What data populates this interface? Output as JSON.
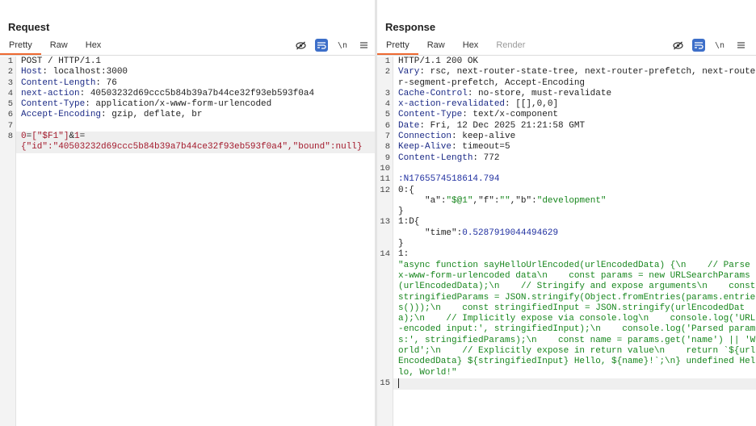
{
  "request": {
    "title": "Request",
    "tabs": [
      "Pretty",
      "Raw",
      "Hex"
    ],
    "lines": [
      {
        "n": "1",
        "parts": [
          {
            "t": "POST / HTTP/1.1",
            "c": "v"
          }
        ]
      },
      {
        "n": "2",
        "parts": [
          {
            "t": "Host",
            "c": "k"
          },
          {
            "t": ": localhost:3000",
            "c": "v"
          }
        ]
      },
      {
        "n": "3",
        "parts": [
          {
            "t": "Content-Length",
            "c": "k"
          },
          {
            "t": ": 76",
            "c": "v"
          }
        ]
      },
      {
        "n": "4",
        "parts": [
          {
            "t": "next-action",
            "c": "k"
          },
          {
            "t": ": 40503232d69ccc5b84b39a7b44ce32f93eb593f0a4",
            "c": "v"
          }
        ]
      },
      {
        "n": "5",
        "parts": [
          {
            "t": "Content-Type",
            "c": "k"
          },
          {
            "t": ": application/x-www-form-urlencoded",
            "c": "v"
          }
        ]
      },
      {
        "n": "6",
        "parts": [
          {
            "t": "Accept-Encoding",
            "c": "k"
          },
          {
            "t": ": gzip, deflate, br",
            "c": "v"
          }
        ]
      },
      {
        "n": "7",
        "parts": [
          {
            "t": "",
            "c": "v"
          }
        ]
      },
      {
        "n": "8",
        "hl": true,
        "parts": [
          {
            "t": "0",
            "c": "red"
          },
          {
            "t": "=",
            "c": "v"
          },
          {
            "t": "[\"$F1\"]",
            "c": "red"
          },
          {
            "t": "&",
            "c": "v"
          },
          {
            "t": "1",
            "c": "red"
          },
          {
            "t": "=",
            "c": "v"
          },
          {
            "t": "\n{\"id\":\"40503232d69ccc5b84b39a7b44ce32f93eb593f0a4\",\"bound\":null}",
            "c": "red"
          }
        ]
      }
    ]
  },
  "response": {
    "title": "Response",
    "tabs": [
      "Pretty",
      "Raw",
      "Hex",
      "Render"
    ],
    "lines": [
      {
        "n": "1",
        "parts": [
          {
            "t": "HTTP/1.1 200 OK",
            "c": "v"
          }
        ]
      },
      {
        "n": "2",
        "parts": [
          {
            "t": "Vary",
            "c": "k"
          },
          {
            "t": ": rsc, next-router-state-tree, next-router-prefetch, next-router-segment-prefetch, Accept-Encoding",
            "c": "v"
          }
        ]
      },
      {
        "n": "3",
        "parts": [
          {
            "t": "Cache-Control",
            "c": "k"
          },
          {
            "t": ": no-store, must-revalidate",
            "c": "v"
          }
        ]
      },
      {
        "n": "4",
        "parts": [
          {
            "t": "x-action-revalidated",
            "c": "k"
          },
          {
            "t": ": [[],0,0]",
            "c": "v"
          }
        ]
      },
      {
        "n": "5",
        "parts": [
          {
            "t": "Content-Type",
            "c": "k"
          },
          {
            "t": ": text/x-component",
            "c": "v"
          }
        ]
      },
      {
        "n": "6",
        "parts": [
          {
            "t": "Date",
            "c": "k"
          },
          {
            "t": ": Fri, 12 Dec 2025 21:21:58 GMT",
            "c": "v"
          }
        ]
      },
      {
        "n": "7",
        "parts": [
          {
            "t": "Connection",
            "c": "k"
          },
          {
            "t": ": keep-alive",
            "c": "v"
          }
        ]
      },
      {
        "n": "8",
        "parts": [
          {
            "t": "Keep-Alive",
            "c": "k"
          },
          {
            "t": ": timeout=5",
            "c": "v"
          }
        ]
      },
      {
        "n": "9",
        "parts": [
          {
            "t": "Content-Length",
            "c": "k"
          },
          {
            "t": ": 772",
            "c": "v"
          }
        ]
      },
      {
        "n": "10",
        "parts": [
          {
            "t": "",
            "c": "v"
          }
        ]
      },
      {
        "n": "11",
        "parts": [
          {
            "t": ":N1765574518614.794",
            "c": "num"
          }
        ]
      },
      {
        "n": "12",
        "parts": [
          {
            "t": "0:{\n     ",
            "c": "v"
          },
          {
            "t": "\"a\"",
            "c": "v"
          },
          {
            "t": ":",
            "c": "v"
          },
          {
            "t": "\"$@1\"",
            "c": "str"
          },
          {
            "t": ",",
            "c": "v"
          },
          {
            "t": "\"f\"",
            "c": "v"
          },
          {
            "t": ":",
            "c": "v"
          },
          {
            "t": "\"\"",
            "c": "str"
          },
          {
            "t": ",",
            "c": "v"
          },
          {
            "t": "\"b\"",
            "c": "v"
          },
          {
            "t": ":",
            "c": "v"
          },
          {
            "t": "\"development\"",
            "c": "str"
          },
          {
            "t": "\n}",
            "c": "v"
          }
        ]
      },
      {
        "n": "13",
        "parts": [
          {
            "t": "1:D{\n     ",
            "c": "v"
          },
          {
            "t": "\"time\"",
            "c": "v"
          },
          {
            "t": ":",
            "c": "v"
          },
          {
            "t": "0.5287919044494629",
            "c": "num"
          },
          {
            "t": "\n}",
            "c": "v"
          }
        ]
      },
      {
        "n": "14",
        "parts": [
          {
            "t": "1:\n",
            "c": "v"
          },
          {
            "t": "\"async function sayHelloUrlEncoded(urlEncodedData) {\\n    // Parse x-www-form-urlencoded data\\n    const params = new URLSearchParams(urlEncodedData);\\n    // Stringify and expose arguments\\n    const stringifiedParams = JSON.stringify(Object.fromEntries(params.entries()));\\n    const stringifiedInput = JSON.stringify(urlEncodedData);\\n    // Implicitly expose via console.log\\n    console.log('URL-encoded input:', stringifiedInput);\\n    console.log('Parsed params:', stringifiedParams);\\n    const name = params.get('name') || 'World';\\n    // Explicitly expose in return value\\n    return `${urlEncodedData} ${stringifiedInput} Hello, ${name}!`;\\n} undefined Hello, World!\"",
            "c": "str"
          }
        ]
      },
      {
        "n": "15",
        "hl": true,
        "cursor": true,
        "parts": [
          {
            "t": "",
            "c": "v"
          }
        ]
      }
    ]
  },
  "icons": {
    "hide": "eye-slash-icon",
    "wrap": "word-wrap-icon",
    "newline_label": "\\n",
    "menu": "hamburger-menu-icon",
    "layout_split": "split-columns-icon",
    "layout_rows": "stacked-rows-icon",
    "layout_single": "single-pane-icon"
  },
  "colors": {
    "accent": "#ee6a32",
    "active_tool": "#3d6fc9",
    "header_key": "#1b2a86",
    "param_red": "#a3192b",
    "string_green": "#17861d"
  }
}
